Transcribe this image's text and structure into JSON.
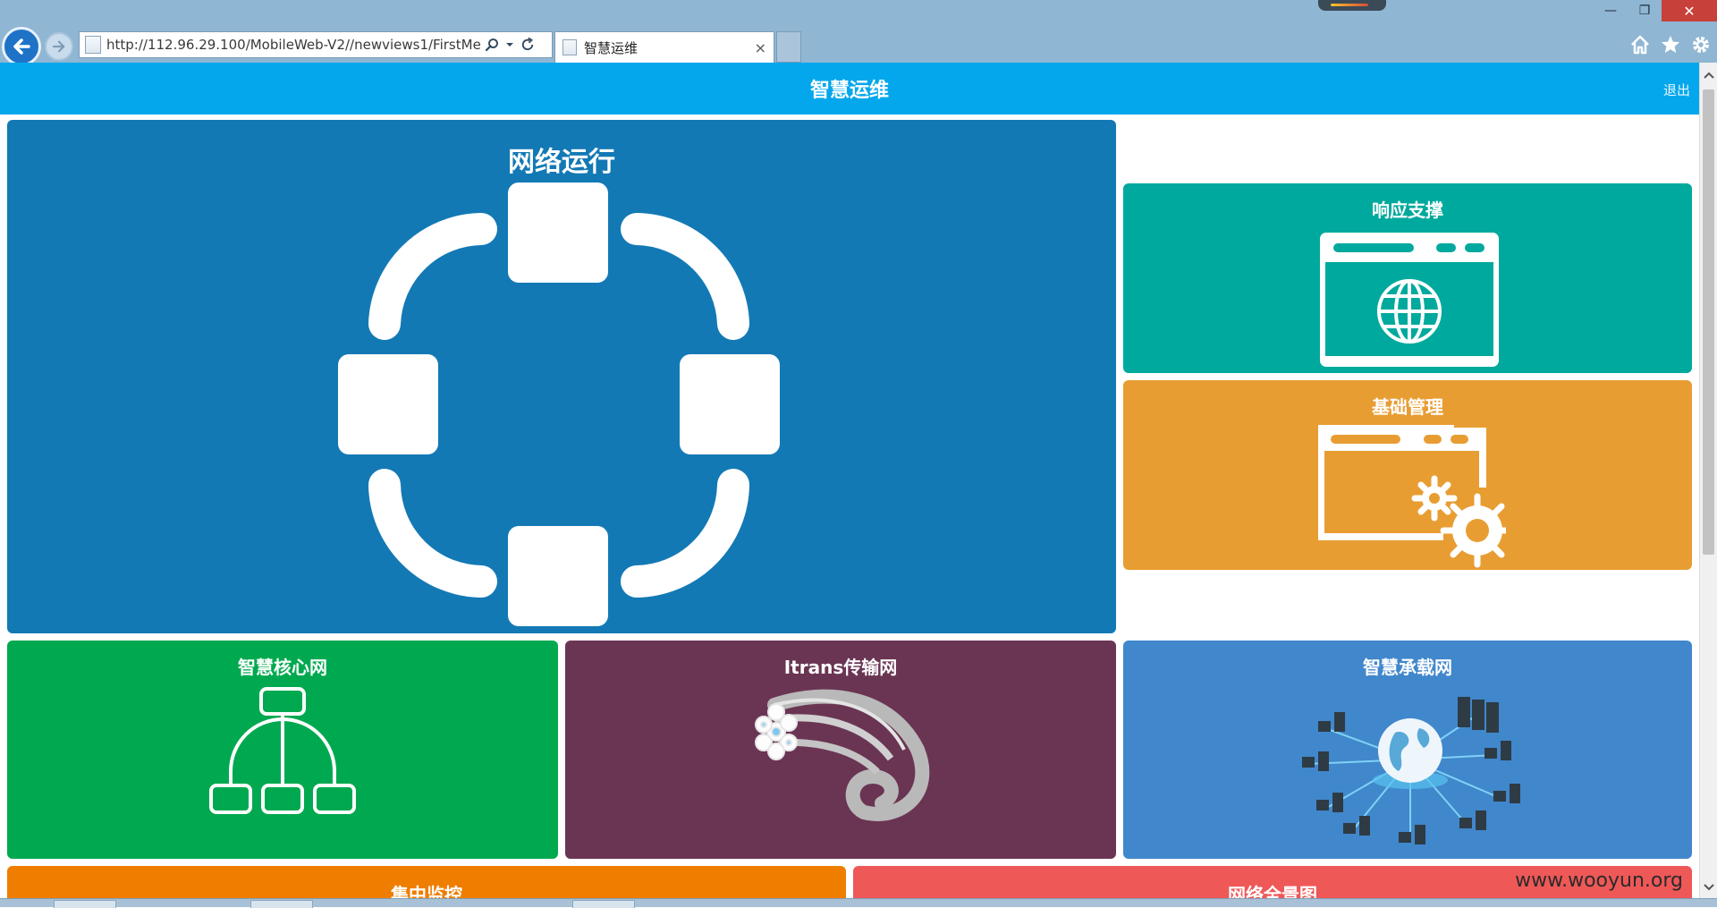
{
  "browser": {
    "url": "http://112.96.29.100/MobileWeb-V2//newviews1/FirstMe",
    "tab_title": "智慧运维",
    "tab_close": "×",
    "minimize": "—",
    "restore": "❐",
    "close": "✕"
  },
  "app": {
    "title": "智慧运维",
    "logout": "退出"
  },
  "tiles": {
    "network": {
      "label": "网络运行",
      "color": "#1379b5"
    },
    "response": {
      "label": "响应支撑",
      "color": "#00a99d"
    },
    "basic": {
      "label": "基础管理",
      "color": "#e89d32"
    },
    "core": {
      "label": "智慧核心网",
      "color": "#00a94f"
    },
    "itrans": {
      "label": "Itrans传输网",
      "color": "#6a3553"
    },
    "bearer": {
      "label": "智慧承载网",
      "color": "#4187cc"
    },
    "monitor": {
      "label": "集中监控",
      "color": "#ef7d00"
    },
    "panorama": {
      "label": "网络全景图",
      "color": "#ee5857"
    }
  },
  "watermark": "www.wooyun.org",
  "icons": {
    "back": "back-arrow-icon",
    "forward": "forward-arrow-icon",
    "search": "search-icon",
    "refresh": "refresh-icon",
    "home": "home-icon",
    "favorites": "star-icon",
    "settings": "gear-icon"
  }
}
